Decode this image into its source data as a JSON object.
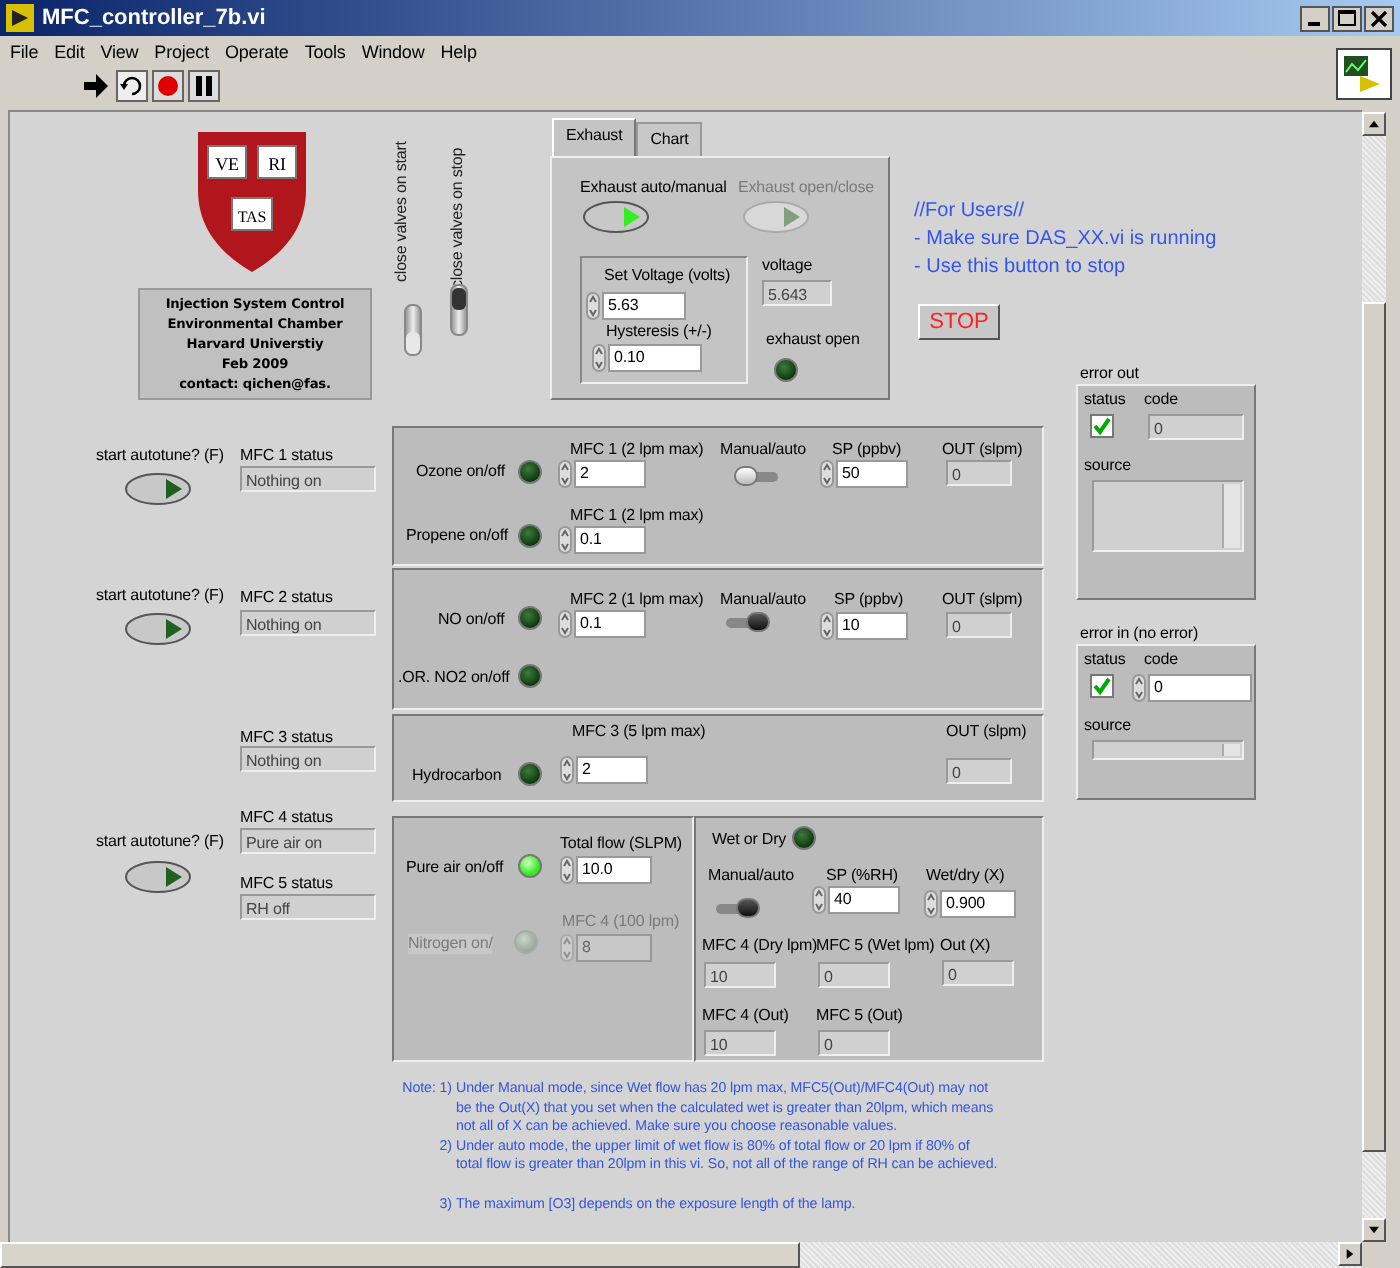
{
  "window": {
    "title": "MFC_controller_7b.vi"
  },
  "menu": [
    "File",
    "Edit",
    "View",
    "Project",
    "Operate",
    "Tools",
    "Window",
    "Help"
  ],
  "logo": {
    "words": [
      "VE",
      "RI",
      "TAS"
    ]
  },
  "info_box": {
    "lines": [
      "Injection System Control",
      "Environmental Chamber",
      "Harvard Universtiy",
      "Feb 2009",
      "contact: qichen@fas."
    ]
  },
  "valve_switches": [
    {
      "label": "close valves on start",
      "on": false
    },
    {
      "label": "close valves on stop",
      "on": true
    }
  ],
  "exhaust_tabs": [
    {
      "label": "Exhaust",
      "selected": true
    },
    {
      "label": "Chart",
      "selected": false
    }
  ],
  "exhaust": {
    "buttons": [
      {
        "label": "Exhaust auto/manual",
        "on": true,
        "disabled": false
      },
      {
        "label": "Exhaust open/close",
        "on": false,
        "disabled": true
      }
    ],
    "set_voltage": {
      "label": "Set Voltage (volts)",
      "value": "5.63"
    },
    "hysteresis": {
      "label": "Hysteresis (+/-)",
      "value": "0.10"
    },
    "voltage": {
      "label": "voltage",
      "value": "5.643"
    },
    "exhaust_open": {
      "label": "exhaust open",
      "on": false
    }
  },
  "users_note": {
    "lines": [
      "//For Users//",
      "-  Make sure DAS_XX.vi is running",
      "-  Use this button to stop"
    ]
  },
  "stop_button": "STOP",
  "autotune": [
    {
      "label": "start autotune? (F)",
      "on": false
    },
    {
      "label": "start autotune? (F)",
      "on": false
    },
    {
      "label": "start autotune? (F)",
      "on": false
    }
  ],
  "mfc_statuses": [
    {
      "label": "MFC 1 status",
      "value": "Nothing on"
    },
    {
      "label": "MFC 2 status",
      "value": "Nothing on"
    },
    {
      "label": "MFC 3 status",
      "value": "Nothing on"
    },
    {
      "label": "MFC 4 status",
      "value": "Pure air on"
    },
    {
      "label": "MFC 5 status",
      "value": "RH off"
    }
  ],
  "mfc_panels": [
    {
      "controls": [
        {
          "kind": "led",
          "label": "Ozone on/off",
          "on": false
        },
        {
          "kind": "numeric",
          "label": "MFC 1 (2 lpm max)",
          "value": "2"
        },
        {
          "kind": "switch",
          "label": "Manual/auto",
          "on": false
        },
        {
          "kind": "numeric",
          "label": "SP (ppbv)",
          "value": "50"
        },
        {
          "kind": "indicator",
          "label": "OUT (slpm)",
          "value": "0"
        },
        {
          "kind": "led",
          "label": "Propene on/off",
          "on": false
        },
        {
          "kind": "numeric",
          "label": "MFC 1 (2 lpm max)",
          "value": "0.1"
        }
      ]
    },
    {
      "controls": [
        {
          "kind": "led",
          "label": "NO on/off",
          "on": false
        },
        {
          "kind": "numeric",
          "label": "MFC 2 (1 lpm max)",
          "value": "0.1"
        },
        {
          "kind": "switch",
          "label": "Manual/auto",
          "on": true
        },
        {
          "kind": "numeric",
          "label": "SP (ppbv)",
          "value": "10"
        },
        {
          "kind": "indicator",
          "label": "OUT (slpm)",
          "value": "0"
        },
        {
          "kind": "led",
          "label": ".OR. NO2 on/off",
          "on": false
        }
      ]
    },
    {
      "controls": [
        {
          "kind": "led",
          "label": "Hydrocarbon",
          "on": false
        },
        {
          "kind": "numeric",
          "label": "MFC 3 (5 lpm max)",
          "value": "2"
        },
        {
          "kind": "indicator",
          "label": "OUT (slpm)",
          "value": "0"
        }
      ]
    },
    {
      "controls": [
        {
          "kind": "led",
          "label": "Pure air on/off",
          "on": true,
          "disabled": false
        },
        {
          "kind": "numeric",
          "label": "Total flow (SLPM)",
          "value": "10.0",
          "disabled": false
        },
        {
          "kind": "led",
          "label": "Nitrogen on/",
          "on": false,
          "disabled": true
        },
        {
          "kind": "numeric",
          "label": "MFC 4 (100 lpm)",
          "value": "8",
          "disabled": true
        }
      ]
    },
    {
      "controls": [
        {
          "kind": "led",
          "label": "Wet or Dry",
          "on": false
        },
        {
          "kind": "switch",
          "label": "Manual/auto",
          "on": true
        },
        {
          "kind": "numeric",
          "label": "SP (%RH)",
          "value": "40"
        },
        {
          "kind": "numeric",
          "label": "Wet/dry (X)",
          "value": "0.900"
        },
        {
          "kind": "indicator",
          "label": "MFC 4 (Dry lpm)",
          "value": "10"
        },
        {
          "kind": "indicator",
          "label": "MFC 5 (Wet lpm)",
          "value": "0"
        },
        {
          "kind": "indicator",
          "label": "Out (X)",
          "value": "0"
        },
        {
          "kind": "indicator",
          "label": "MFC 4 (Out)",
          "value": "10"
        },
        {
          "kind": "indicator",
          "label": "MFC 5 (Out)",
          "value": "0"
        }
      ]
    }
  ],
  "error_clusters": [
    {
      "label": "error out",
      "kind": "indicator",
      "status_label": "status",
      "code_label": "code",
      "status": true,
      "code": "0",
      "source_label": "source"
    },
    {
      "label": "error in (no error)",
      "kind": "control",
      "status_label": "status",
      "code_label": "code",
      "status": true,
      "code": "0",
      "source_label": "source"
    }
  ],
  "note": [
    {
      "marker": "Note: 1)",
      "lines": [
        "Under Manual mode, since Wet flow has 20 lpm max, MFC5(Out)/MFC4(Out) may not",
        "be the Out(X) that you set when the  calculated wet is greater than 20lpm, which means",
        "not all of X can be achieved. Make sure you choose reasonable values."
      ]
    },
    {
      "marker": "2)",
      "lines": [
        "Under auto mode, the upper limit of wet flow is 80% of total flow or 20 lpm if 80% of",
        "total flow is greater than 20lpm in this vi. So, not all of the range of RH can be achieved."
      ]
    },
    {
      "marker": "3)",
      "lines": [
        "The maximum [O3] depends on the exposure length of the lamp."
      ]
    }
  ]
}
